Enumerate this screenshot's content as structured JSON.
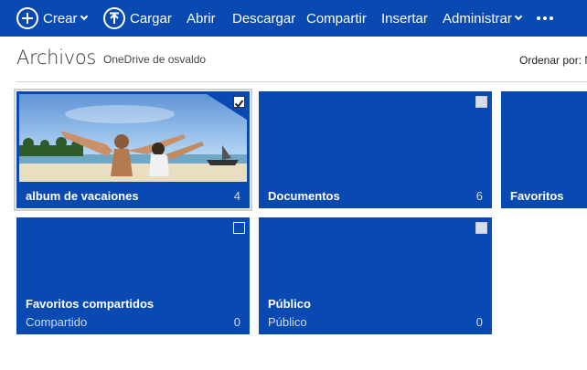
{
  "toolbar": {
    "create_label": "Crear",
    "upload_label": "Cargar",
    "open_label": "Abrir",
    "download_label": "Descargar",
    "share_label": "Compartir",
    "embed_label": "Insertar",
    "manage_label": "Administrar"
  },
  "header": {
    "title": "Archivos",
    "subtitle": "OneDrive de osvaldo",
    "sort_label": "Ordenar por: N"
  },
  "colors": {
    "accent": "#094ab2",
    "sky": "#7fb3e6",
    "sand": "#e9ddc2"
  },
  "tiles": [
    {
      "name": "album de vacaiones",
      "count": "4",
      "subtitle": "",
      "selected": true
    },
    {
      "name": "Documentos",
      "count": "6",
      "subtitle": ""
    },
    {
      "name": "Favoritos",
      "count": "",
      "subtitle": ""
    },
    {
      "name": "Favoritos compartidos",
      "count": "0",
      "subtitle": "Compartido"
    },
    {
      "name": "Público",
      "count": "0",
      "subtitle": "Público"
    }
  ]
}
